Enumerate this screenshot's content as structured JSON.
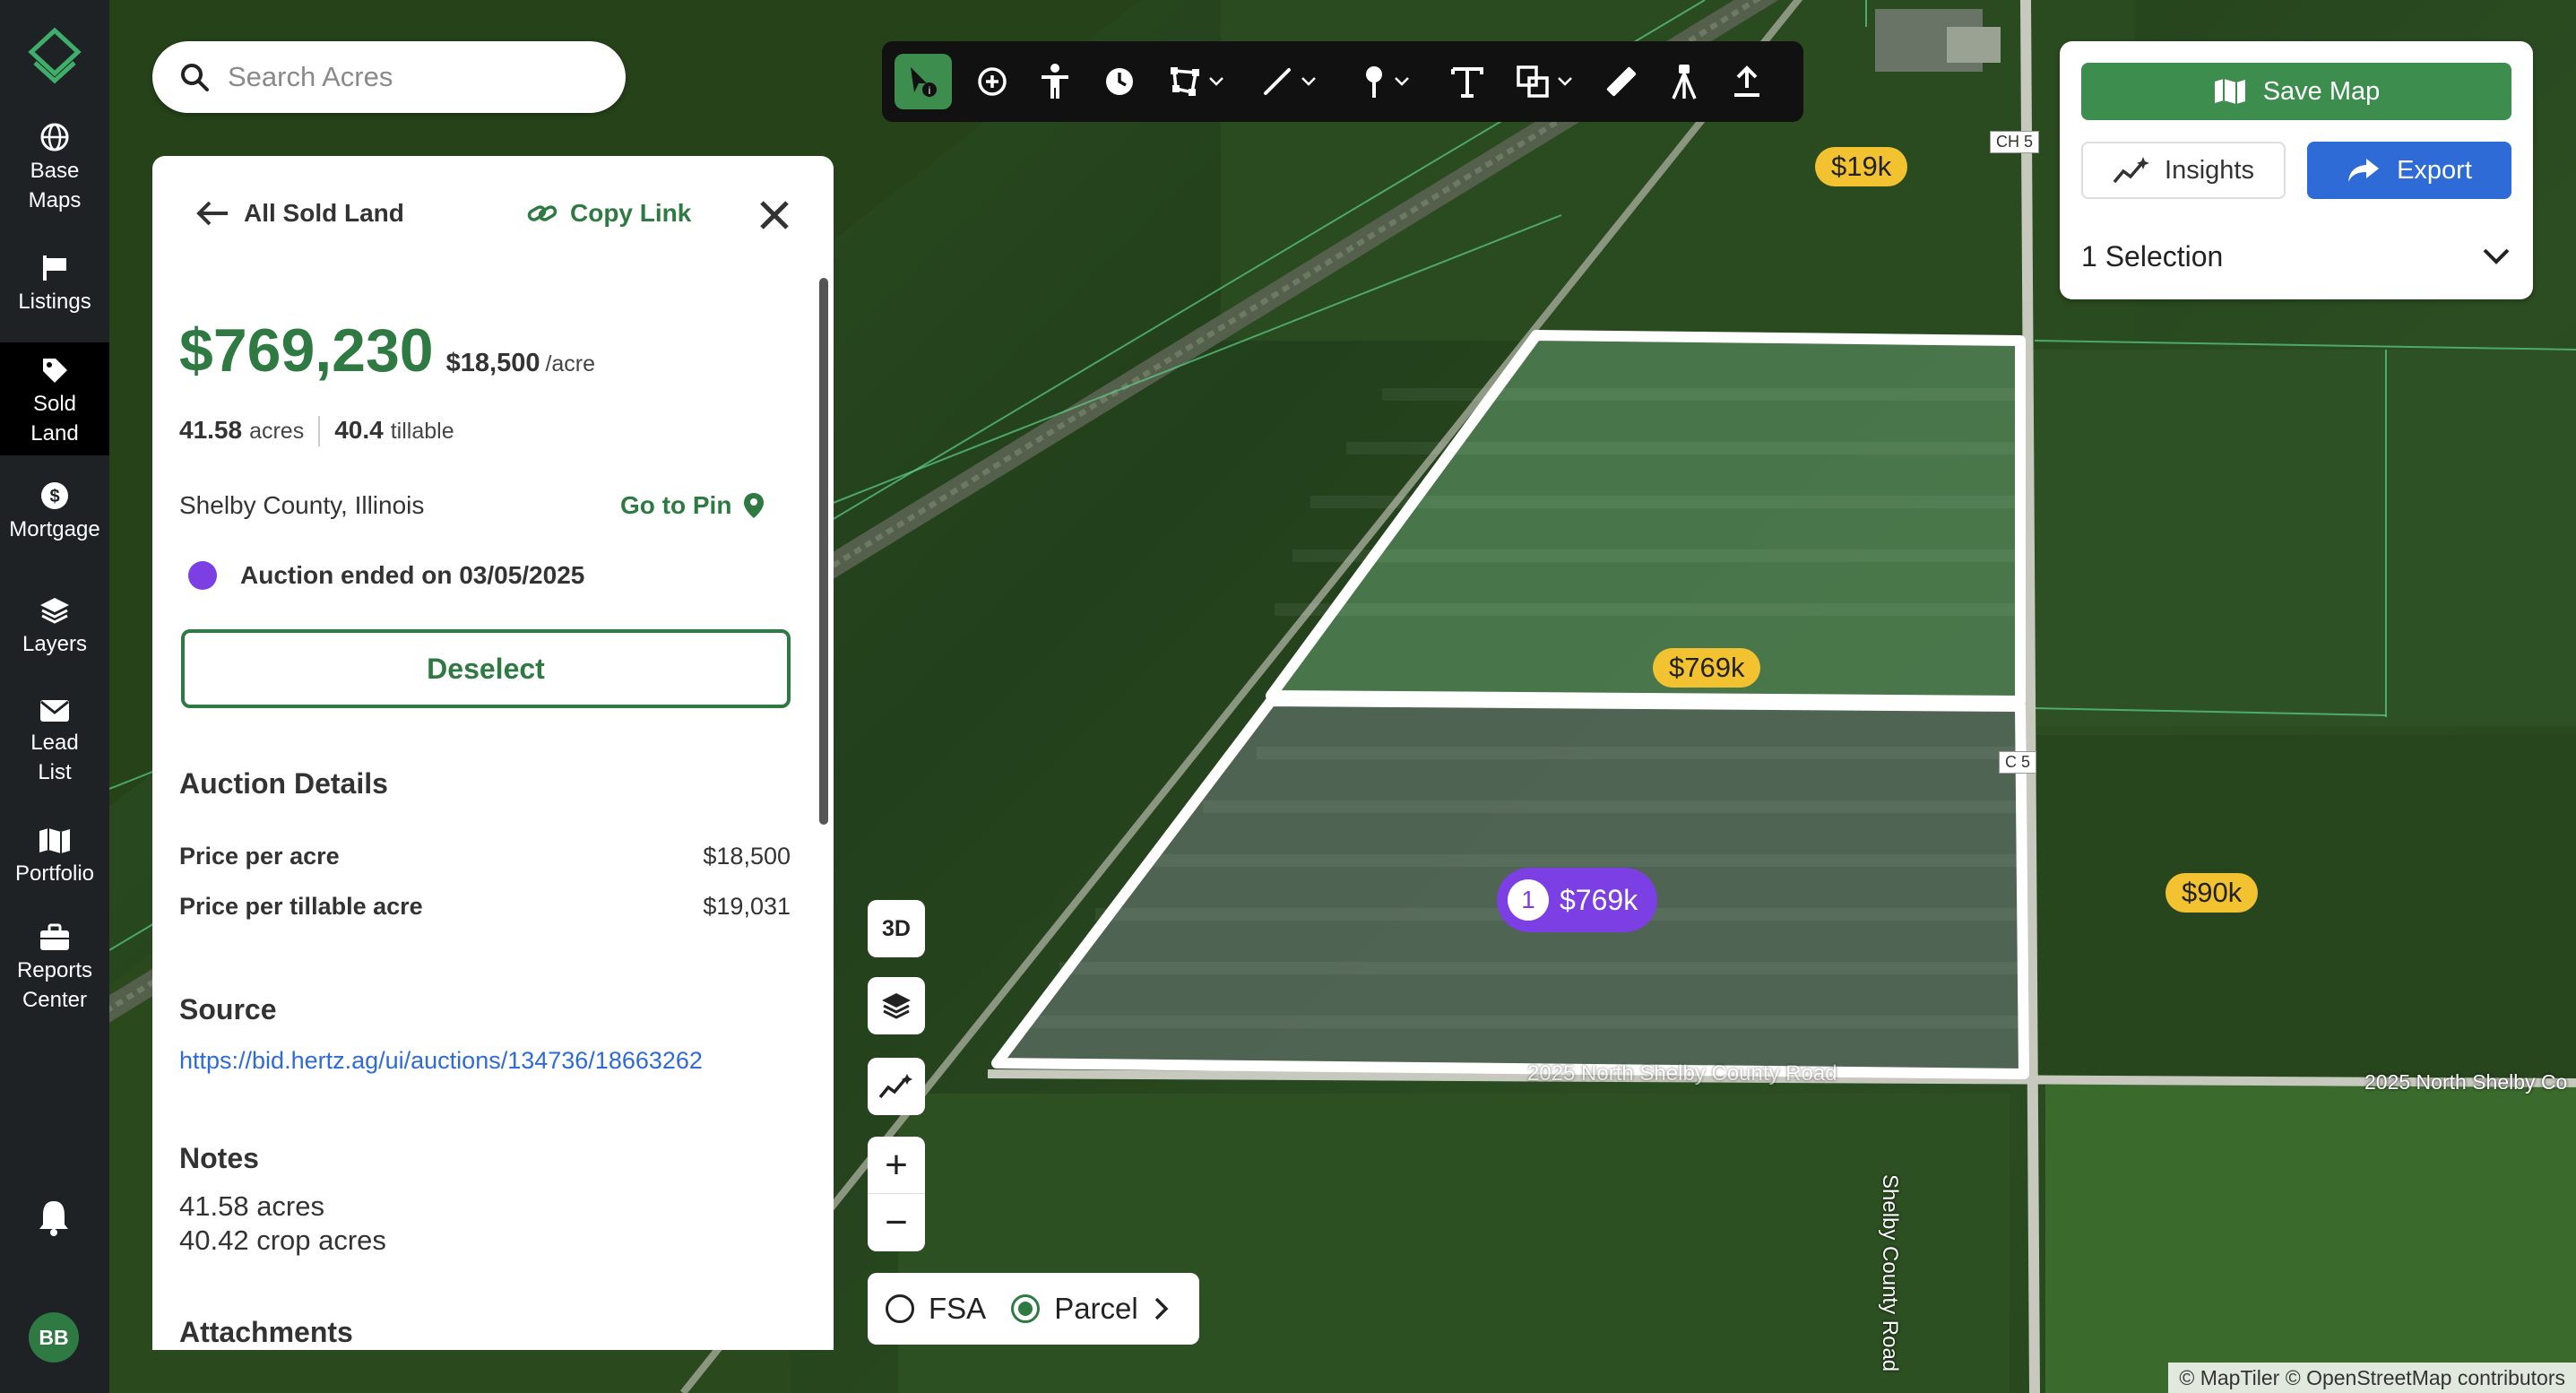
{
  "nav": {
    "items": [
      {
        "label": "Base\nMaps",
        "icon": "globe-icon"
      },
      {
        "label": "Listings",
        "icon": "flag-sign-icon"
      },
      {
        "label": "Sold\nLand",
        "icon": "tag-icon",
        "active": true
      },
      {
        "label": "Mortgage",
        "icon": "dollar-circle-icon"
      },
      {
        "label": "Layers",
        "icon": "layers-icon"
      },
      {
        "label": "Lead\nList",
        "icon": "envelope-icon"
      },
      {
        "label": "Portfolio",
        "icon": "map-icon"
      },
      {
        "label": "Reports\nCenter",
        "icon": "briefcase-icon"
      }
    ],
    "avatar": "BB"
  },
  "search": {
    "placeholder": "Search Acres"
  },
  "toolbar": {
    "tools": [
      "select-info-icon",
      "add-circle-icon",
      "person-icon",
      "clock-icon",
      "polygon-icon",
      "line-icon",
      "pin-icon",
      "text-icon",
      "shapes-icon",
      "ruler-icon",
      "survey-tripod-icon",
      "upload-icon"
    ]
  },
  "panel": {
    "back_label": "All Sold Land",
    "copy_link_label": "Copy Link",
    "price": "$769,230",
    "price_per_acre": "$18,500",
    "per_acre_unit": "/acre",
    "acres_value": "41.58",
    "acres_unit": "acres",
    "tillable_value": "40.4",
    "tillable_unit": "tillable",
    "location": "Shelby County, Illinois",
    "go_to_pin_label": "Go to Pin",
    "auction_status": "Auction ended on 03/05/2025",
    "status_color": "#7b3fe4",
    "deselect_label": "Deselect",
    "auction_details_title": "Auction Details",
    "details": [
      {
        "label": "Price per acre",
        "value": "$18,500"
      },
      {
        "label": "Price per tillable acre",
        "value": "$19,031"
      }
    ],
    "source_title": "Source",
    "source_url": "https://bid.hertz.ag/ui/auctions/134736/18663262",
    "notes_title": "Notes",
    "notes_lines": [
      "41.58 acres",
      "40.42 crop acres"
    ],
    "attachments_title": "Attachments"
  },
  "right_panel": {
    "save_map_label": "Save Map",
    "insights_label": "Insights",
    "export_label": "Export",
    "selection_label": "1 Selection"
  },
  "map_controls": {
    "three_d_label": "3D",
    "zoom_in": "+",
    "zoom_out": "−",
    "fsa_label": "FSA",
    "parcel_label": "Parcel"
  },
  "map": {
    "tags": [
      {
        "label": "$19k"
      },
      {
        "label": "$769k"
      },
      {
        "label": "$90k"
      }
    ],
    "selected_tag": {
      "count": "1",
      "label": "$769k"
    },
    "shields": [
      "CH 5",
      "C  5"
    ],
    "road_labels": [
      "2025 North Shelby Co",
      "2025 North Shelby County Road",
      "Shelby County Road"
    ],
    "attribution": "© MapTiler © OpenStreetMap contributors",
    "colors": {
      "accent_green": "#3c8d4e",
      "export_blue": "#2e6bd6",
      "price_tag": "#f2c230",
      "selected_tag": "#7b3fe4"
    }
  }
}
